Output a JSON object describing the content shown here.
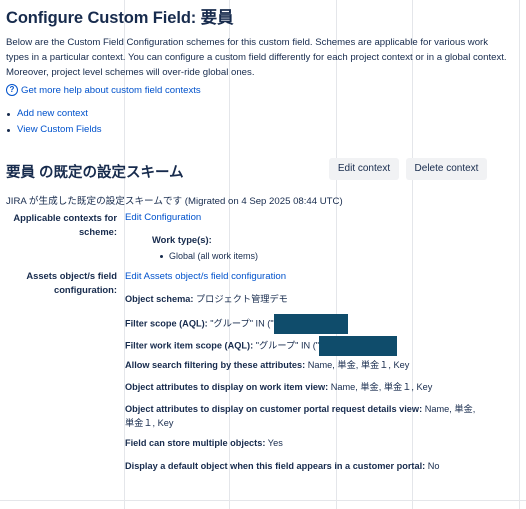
{
  "page": {
    "title": "Configure Custom Field: 要員",
    "description": "Below are the Custom Field Configuration schemes for this custom field. Schemes are applicable for various work types in a particular context. You can configure a custom field differently for each project context or in a global context. Moreover, project level schemes will over-ride global ones.",
    "help_link": "Get more help about custom field contexts",
    "links": [
      "Add new context",
      "View Custom Fields"
    ]
  },
  "scheme": {
    "title": "要員 の既定の設定スキーム",
    "edit_button": "Edit context",
    "delete_button": "Delete context",
    "created_note": "JIRA が生成した既定の設定スキームです (Migrated on 4 Sep 2025 08:44 UTC)",
    "contexts_label": "Applicable contexts for scheme:",
    "edit_configuration": "Edit Configuration",
    "work_types_label": "Work type(s):",
    "work_type_value": "Global (all work items)",
    "assets_label": "Assets object/s field configuration:",
    "assets_link": "Edit Assets object/s field configuration",
    "attributes": [
      {
        "label": "Object schema:",
        "value": "プロジェクト管理デモ"
      },
      {
        "label": "Filter scope (AQL):",
        "value": "\"グループ\" IN (\""
      },
      {
        "label": "Filter work item scope (AQL):",
        "value": "\"グループ\" IN (\""
      },
      {
        "label": "Allow search filtering by these attributes:",
        "value": "Name, 単金, 単金１, Key"
      },
      {
        "label": "Object attributes to display on work item view:",
        "value": "Name, 単金, 単金１, Key"
      },
      {
        "label": "Object attributes to display on customer portal request details view:",
        "value": "Name, 単金, 単金１, Key"
      },
      {
        "label": "Field can store multiple objects:",
        "value": "Yes"
      },
      {
        "label": "Display a default object when this field appears in a customer portal:",
        "value": "No"
      }
    ]
  },
  "colors": {
    "text": "#172b4d",
    "link": "#0052cc",
    "button_bg": "#f1f2f4",
    "redaction": "#0f4c6b"
  }
}
